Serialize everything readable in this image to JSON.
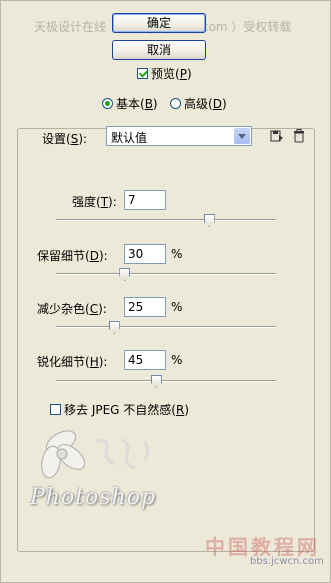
{
  "watermark": {
    "top": "天极设计在线（ design.yesky.com ）受权转载",
    "logo_text": "Photoshop",
    "bottom_cn": "中国教程网",
    "bottom_url": "bbs.jcwcn.com"
  },
  "buttons": {
    "ok": "确定",
    "cancel": "取消"
  },
  "preview": {
    "label_pre": "预览(",
    "key": "P",
    "label_post": ")",
    "checked": true
  },
  "mode": {
    "basic": {
      "pre": "基本(",
      "key": "B",
      "post": ")",
      "selected": true
    },
    "advanced": {
      "pre": "高级(",
      "key": "D",
      "post": ")",
      "selected": false
    }
  },
  "settings": {
    "label_pre": "设置(",
    "key": "S",
    "label_post": "):",
    "value": "默认值",
    "save_icon": "save-preset-icon",
    "delete_icon": "trash-icon"
  },
  "params": {
    "strength": {
      "label_pre": "强度(",
      "key": "T",
      "label_post": "):",
      "value": "7",
      "level_fraction": 0.7
    },
    "preserve_detail": {
      "label_pre": "保留细节(",
      "key": "D",
      "label_post": "):",
      "value": "30",
      "unit": "%",
      "level_fraction": 0.3
    },
    "reduce_color_noise": {
      "label_pre": "减少杂色(",
      "key": "C",
      "label_post": "):",
      "value": "25",
      "unit": "%",
      "level_fraction": 0.25
    },
    "sharpen_detail": {
      "label_pre": "锐化细节(",
      "key": "H",
      "label_post": "):",
      "value": "45",
      "unit": "%",
      "level_fraction": 0.45
    }
  },
  "jpeg_artifact": {
    "pre": "移去 JPEG 不自然感(",
    "key": "R",
    "post": ")",
    "checked": false
  }
}
